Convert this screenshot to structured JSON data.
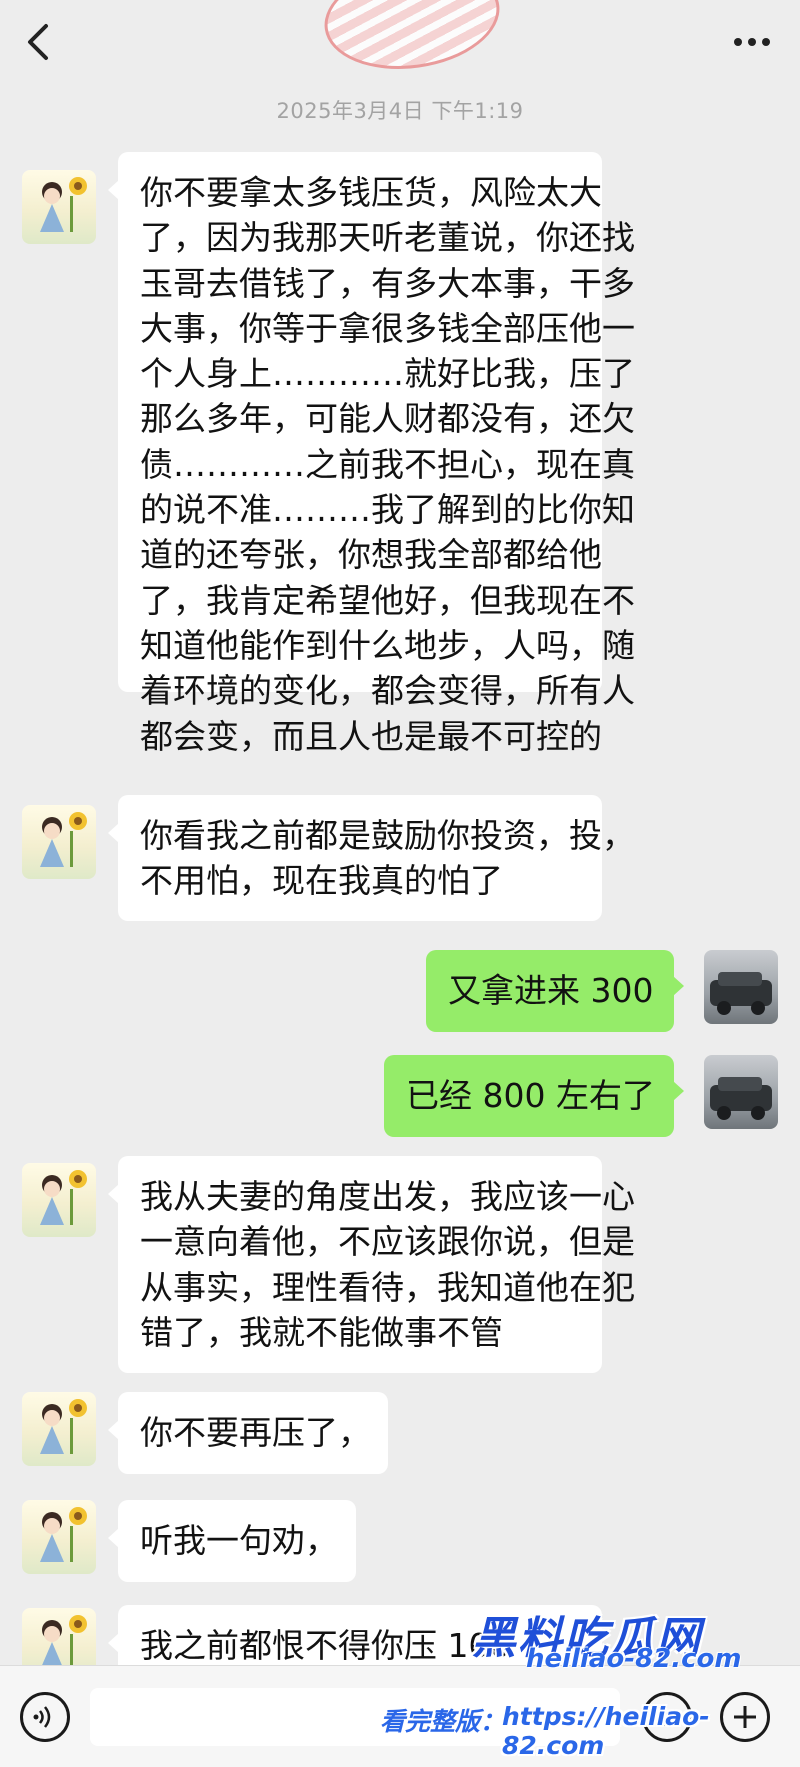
{
  "header": {
    "timestamp": "2025年3月4日 下午1:19"
  },
  "messages": [
    {
      "side": "left",
      "lines": [
        "你不要拿太多钱压货，风险太大",
        "了，因为我那天听老董说，你还找",
        "玉哥去借钱了，有多大本事，干多",
        "大事，你等于拿很多钱全部压他一",
        "个人身上…………就好比我，压了",
        "那么多年，可能人财都没有，还欠",
        "债…………之前我不担心，现在真",
        "的说不准………我了解到的比你知",
        "道的还夸张，你想我全部都给他",
        "了，我肯定希望他好，但我现在不",
        "知道他能作到什么地步，人吗，随",
        "着环境的变化，都会变得，所有人",
        "都会变，而且人也是最不可控的"
      ]
    },
    {
      "side": "left",
      "lines": [
        "你看我之前都是鼓励你投资，投，",
        "不用怕，现在我真的怕了"
      ]
    },
    {
      "side": "right",
      "lines": [
        "又拿进来 300"
      ]
    },
    {
      "side": "right",
      "lines": [
        "已经 800 左右了"
      ]
    },
    {
      "side": "left",
      "lines": [
        "我从夫妻的角度出发，我应该一心",
        "一意向着他，不应该跟你说，但是",
        "从事实，理性看待，我知道他在犯",
        "错了，我就不能做事不管"
      ]
    },
    {
      "side": "left",
      "lines": [
        "你不要再压了，"
      ]
    },
    {
      "side": "left",
      "lines": [
        "听我一句劝，"
      ]
    },
    {
      "side": "left",
      "lines": [
        "我之前都恨不得你压 100"
      ]
    }
  ],
  "watermark": {
    "title": "黑料吃瓜网",
    "site": "heiliao-82.com",
    "prefix": "看完整版：",
    "url": "https://heiliao-82.com"
  },
  "icons": {
    "back": "chevron-left-icon",
    "more": "more-dots-icon",
    "voice": "voice-icon",
    "emoji": "emoji-icon",
    "add": "add-icon"
  },
  "colors": {
    "background": "#ededed",
    "incoming_bubble": "#ffffff",
    "outgoing_bubble": "#95ec69"
  }
}
